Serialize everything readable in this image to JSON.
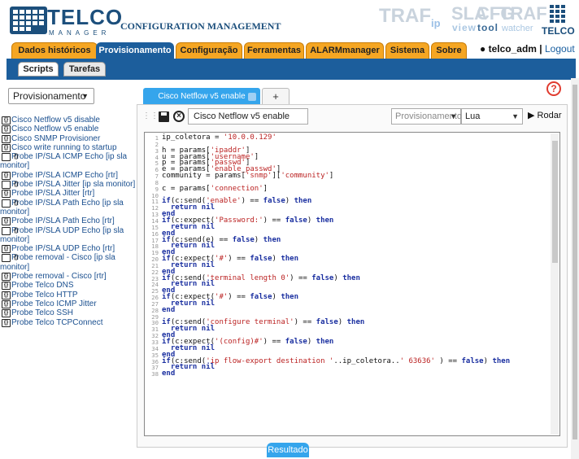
{
  "header": {
    "logo_main": "TELCO",
    "logo_sub": "MANAGER",
    "title": "CONFIGURATION MANAGEMENT",
    "brand_traf": "TRAF",
    "brand_traf_sub": "ip",
    "brand_sla": "SLA",
    "brand_sla_sub": "view",
    "brand_cfg": "CFG",
    "brand_cfg_sub": "tool",
    "brand_traf2": "TRAF",
    "brand_traf2_sub": "watcher",
    "brand_telco": "TELCO"
  },
  "nav": {
    "tabs": [
      "Dados históricos",
      "Provisionamento",
      "Configuração",
      "Ferramentas",
      "ALARMmanager",
      "Sistema",
      "Sobre"
    ],
    "active": "Provisionamento",
    "user": "telco_adm",
    "logout": "Logout",
    "separator": "|"
  },
  "subnav": {
    "tabs": [
      "Scripts",
      "Tarefas"
    ],
    "active": "Scripts"
  },
  "sidebar": {
    "filter_value": "Provisionamento",
    "scripts": [
      "Cisco Netflow v5 disable",
      "Cisco Netflow v5 enable",
      "Cisco SNMP Provisioner",
      "Cisco write running to startup",
      "Probe IP/SLA ICMP Echo [ip sla monitor]",
      "Probe IP/SLA ICMP Echo [rtr]",
      "Probe IP/SLA Jitter [ip sla monitor]",
      "Probe IP/SLA Jitter [rtr]",
      "Probe IP/SLA Path Echo [ip sla monitor]",
      "Probe IP/SLA Path Echo [rtr]",
      "Probe IP/SLA UDP Echo [ip sla monitor]",
      "Probe IP/SLA UDP Echo [rtr]",
      "Probe removal - Cisco [ip sla monitor]",
      "Probe removal - Cisco [rtr]",
      "Probe Telco DNS",
      "Probe Telco HTTP",
      "Probe Telco ICMP Jitter",
      "Probe Telco SSH",
      "Probe Telco TCPConnect"
    ]
  },
  "editor": {
    "tab_label": "Cisco Netflow v5 enable",
    "plus_label": "+",
    "script_name": "Cisco Netflow v5 enable",
    "category": "Provisionamento",
    "language": "Lua",
    "run_label": "Rodar",
    "result_label": "Resultado",
    "help_label": "?",
    "code_lines": [
      "ip_coletora = '10.0.0.129'",
      "",
      "h = params['ipaddr']",
      "u = params['username']",
      "p = params['passwd']",
      "e = params['enable_passwd']",
      "community = params['snmp']['community']",
      "",
      "c = params['connection']",
      "",
      "if(c:send('enable') == false) then",
      "  return nil",
      "end",
      "if(c:expect('Password:') == false) then",
      "  return nil",
      "end",
      "if(c:send(e) == false) then",
      "  return nil",
      "end",
      "if(c:expect('#') == false) then",
      "  return nil",
      "end",
      "if(c:send('terminal length 0') == false) then",
      "  return nil",
      "end",
      "if(c:expect('#') == false) then",
      "  return nil",
      "end",
      "",
      "if(c:send('configure terminal') == false) then",
      "  return nil",
      "end",
      "if(c:expect('(config)#') == false) then",
      "  return nil",
      "end",
      "if(c:send('ip flow-export destination '..ip_coletora..' 63636' ) == false) then",
      "  return nil",
      "end"
    ]
  },
  "colors": {
    "nav_tab": "#f5a623",
    "nav_active": "#1c5e9c",
    "editor_tab": "#35a5ec",
    "help": "#e03b2f",
    "brand": "#1c4f7c"
  }
}
